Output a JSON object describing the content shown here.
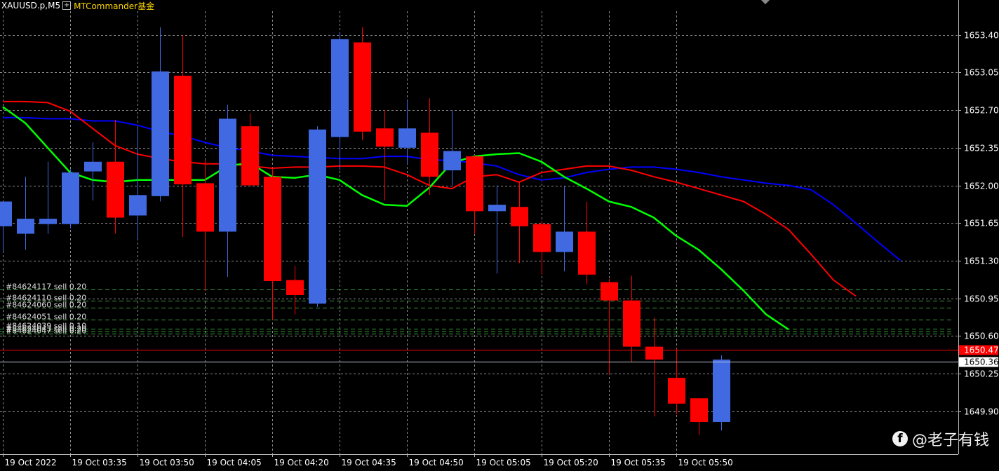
{
  "header": {
    "symbol": "XAUUSD.p,M5",
    "indicator": "MTCommander基金"
  },
  "watermark": {
    "text": "@老子有钱"
  },
  "colors": {
    "background": "#000000",
    "grid": "#8c8c8c",
    "bull": "#4169e1",
    "bear": "#ff0000",
    "ma_fast": "#00ff00",
    "ma_mid": "#ff0000",
    "ma_slow": "#0000ff",
    "order_line": "#3c9a3c",
    "bid_line": "#ff0000",
    "ask_line": "#c0c8d8"
  },
  "chart_data": {
    "type": "candlestick",
    "ylim": [
      1649.5,
      1653.62
    ],
    "grid": true,
    "y_ticks": [
      "1653.40",
      "1653.05",
      "1652.70",
      "1652.35",
      "1652.00",
      "1651.65",
      "1651.30",
      "1650.95",
      "1650.60",
      "1650.25",
      "1649.90"
    ],
    "x_ticks": [
      "19 Oct 2022",
      "19 Oct 03:35",
      "19 Oct 03:50",
      "19 Oct 04:05",
      "19 Oct 04:20",
      "19 Oct 04:35",
      "19 Oct 04:50",
      "19 Oct 05:05",
      "19 Oct 05:20",
      "19 Oct 05:35",
      "19 Oct 05:50"
    ],
    "candles": [
      {
        "o": 1651.62,
        "h": 1651.75,
        "l": 1651.38,
        "c": 1651.85
      },
      {
        "o": 1651.55,
        "h": 1652.08,
        "l": 1651.4,
        "c": 1651.69
      },
      {
        "o": 1651.64,
        "h": 1652.22,
        "l": 1651.55,
        "c": 1651.69
      },
      {
        "o": 1651.64,
        "h": 1652.15,
        "l": 1651.6,
        "c": 1652.12
      },
      {
        "o": 1652.13,
        "h": 1652.4,
        "l": 1651.86,
        "c": 1652.22
      },
      {
        "o": 1652.22,
        "h": 1652.61,
        "l": 1651.55,
        "c": 1651.7
      },
      {
        "o": 1651.72,
        "h": 1652.55,
        "l": 1651.5,
        "c": 1651.91
      },
      {
        "o": 1651.9,
        "h": 1653.47,
        "l": 1651.85,
        "c": 1653.06
      },
      {
        "o": 1653.02,
        "h": 1653.4,
        "l": 1651.52,
        "c": 1652.01
      },
      {
        "o": 1652.02,
        "h": 1652.24,
        "l": 1651.02,
        "c": 1651.57
      },
      {
        "o": 1651.57,
        "h": 1652.75,
        "l": 1651.15,
        "c": 1652.62
      },
      {
        "o": 1652.55,
        "h": 1652.67,
        "l": 1652.0,
        "c": 1652.0
      },
      {
        "o": 1652.08,
        "h": 1652.16,
        "l": 1650.75,
        "c": 1651.11
      },
      {
        "o": 1651.12,
        "h": 1651.25,
        "l": 1650.8,
        "c": 1650.98
      },
      {
        "o": 1650.9,
        "h": 1652.55,
        "l": 1650.87,
        "c": 1652.52
      },
      {
        "o": 1652.45,
        "h": 1653.42,
        "l": 1652.14,
        "c": 1653.36
      },
      {
        "o": 1653.33,
        "h": 1653.47,
        "l": 1652.42,
        "c": 1652.5
      },
      {
        "o": 1652.53,
        "h": 1652.7,
        "l": 1651.86,
        "c": 1652.36
      },
      {
        "o": 1652.35,
        "h": 1652.79,
        "l": 1652.2,
        "c": 1652.53
      },
      {
        "o": 1652.49,
        "h": 1652.81,
        "l": 1651.91,
        "c": 1652.08
      },
      {
        "o": 1652.14,
        "h": 1652.7,
        "l": 1652.0,
        "c": 1652.32
      },
      {
        "o": 1652.27,
        "h": 1652.28,
        "l": 1651.55,
        "c": 1651.76
      },
      {
        "o": 1651.76,
        "h": 1652.0,
        "l": 1651.18,
        "c": 1651.82
      },
      {
        "o": 1651.8,
        "h": 1652.03,
        "l": 1651.28,
        "c": 1651.62
      },
      {
        "o": 1651.64,
        "h": 1651.67,
        "l": 1651.17,
        "c": 1651.38
      },
      {
        "o": 1651.38,
        "h": 1651.99,
        "l": 1651.2,
        "c": 1651.57
      },
      {
        "o": 1651.57,
        "h": 1651.85,
        "l": 1651.08,
        "c": 1651.17
      },
      {
        "o": 1651.1,
        "h": 1651.13,
        "l": 1650.24,
        "c": 1650.93
      },
      {
        "o": 1650.93,
        "h": 1651.16,
        "l": 1650.36,
        "c": 1650.5
      },
      {
        "o": 1650.5,
        "h": 1650.77,
        "l": 1649.85,
        "c": 1650.38
      },
      {
        "o": 1650.21,
        "h": 1650.48,
        "l": 1649.87,
        "c": 1649.97
      },
      {
        "o": 1650.02,
        "h": 1650.02,
        "l": 1649.68,
        "c": 1649.8
      },
      {
        "o": 1649.8,
        "h": 1650.42,
        "l": 1649.72,
        "c": 1650.38
      }
    ],
    "ma_fast": [
      1652.73,
      1652.58,
      1652.35,
      1652.12,
      1652.05,
      1652.03,
      1652.05,
      1652.05,
      1652.05,
      1652.05,
      1652.18,
      1652.21,
      1652.08,
      1652.07,
      1652.1,
      1652.05,
      1651.91,
      1651.82,
      1651.81,
      1651.98,
      1652.21,
      1652.27,
      1652.29,
      1652.3,
      1652.22,
      1652.08,
      1651.97,
      1651.85,
      1651.8,
      1651.7,
      1651.53,
      1651.4,
      1651.22,
      1651.02,
      1650.8,
      1650.66
    ],
    "ma_mid": [
      1652.78,
      1652.78,
      1652.77,
      1652.69,
      1652.53,
      1652.37,
      1652.29,
      1652.25,
      1652.22,
      1652.2,
      1652.2,
      1652.18,
      1652.16,
      1652.17,
      1652.17,
      1652.18,
      1652.18,
      1652.17,
      1652.1,
      1652.0,
      1651.97,
      1652.08,
      1652.1,
      1652.03,
      1652.12,
      1652.15,
      1652.18,
      1652.18,
      1652.14,
      1652.08,
      1652.03,
      1651.97,
      1651.91,
      1651.85,
      1651.73,
      1651.59,
      1651.36,
      1651.12,
      1650.97
    ],
    "ma_slow": [
      1652.63,
      1652.63,
      1652.62,
      1652.62,
      1652.6,
      1652.6,
      1652.56,
      1652.5,
      1652.46,
      1652.4,
      1652.35,
      1652.32,
      1652.28,
      1652.27,
      1652.26,
      1652.25,
      1652.25,
      1652.27,
      1652.27,
      1652.24,
      1652.23,
      1652.21,
      1652.18,
      1652.1,
      1652.05,
      1652.07,
      1652.12,
      1652.15,
      1652.17,
      1652.17,
      1652.15,
      1652.12,
      1652.08,
      1652.05,
      1652.02,
      1652.0,
      1651.96,
      1651.82,
      1651.65,
      1651.47,
      1651.3
    ],
    "orders": [
      {
        "label": "#84624117 sell 0.20",
        "price": 1651.03
      },
      {
        "label": "#84624110 sell 0.20",
        "price": 1650.93
      },
      {
        "label": "#84624060 sell 0.20",
        "price": 1650.86
      },
      {
        "label": "#84624051 sell 0.20",
        "price": 1650.75
      },
      {
        "label": "#84624039 sell 0.10",
        "price": 1650.67
      },
      {
        "label": "#84624043 sell 0.20",
        "price": 1650.64
      },
      {
        "label": "#84624047 sell 0.20",
        "price": 1650.62
      }
    ],
    "bid": {
      "label": "1650.47",
      "price": 1650.47
    },
    "ask": {
      "label": "1650.36",
      "price": 1650.36
    }
  }
}
